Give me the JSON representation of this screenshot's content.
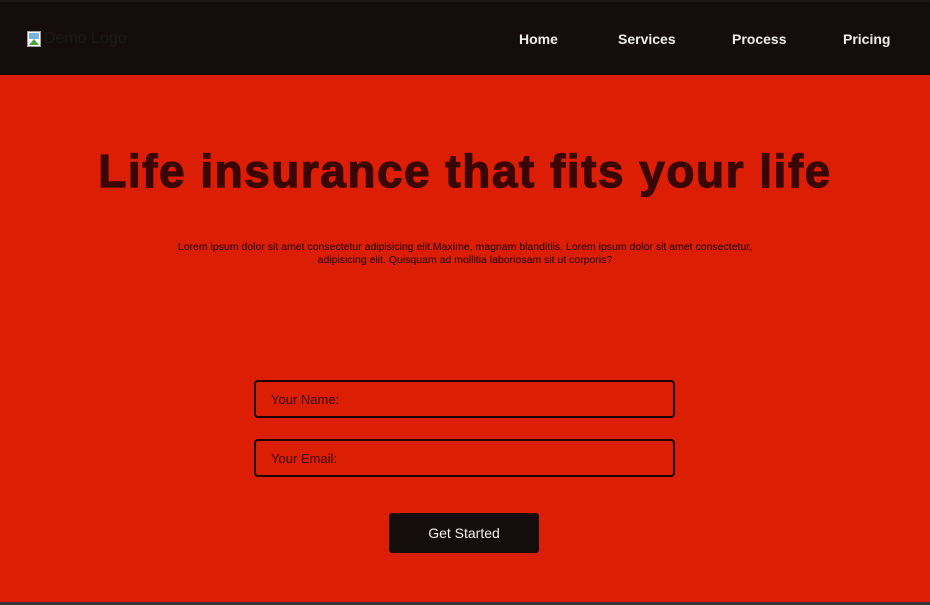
{
  "header": {
    "logo_alt": "Demo Logo",
    "nav": [
      {
        "label": "Home"
      },
      {
        "label": "Services"
      },
      {
        "label": "Process"
      },
      {
        "label": "Pricing"
      }
    ]
  },
  "hero": {
    "title": "Life insurance that fits your life",
    "subtitle": "Lorem ipsum dolor sit amet consectetur adipisicing elit.Maxime, magnam blanditiis. Lorem ipsum dolor sit amet consectetur, adipisicing elit. Quisquam ad mollitia laboriosam sit ut corporis?"
  },
  "form": {
    "name_placeholder": "Your Name:",
    "email_placeholder": "Your Email:",
    "submit_label": "Get Started"
  },
  "colors": {
    "navbar_bg": "#140d0c",
    "hero_bg": "#dc1e04",
    "title_color": "#3a0502",
    "button_bg": "#140d0c"
  },
  "icons": {
    "logo": "broken-image-icon"
  }
}
